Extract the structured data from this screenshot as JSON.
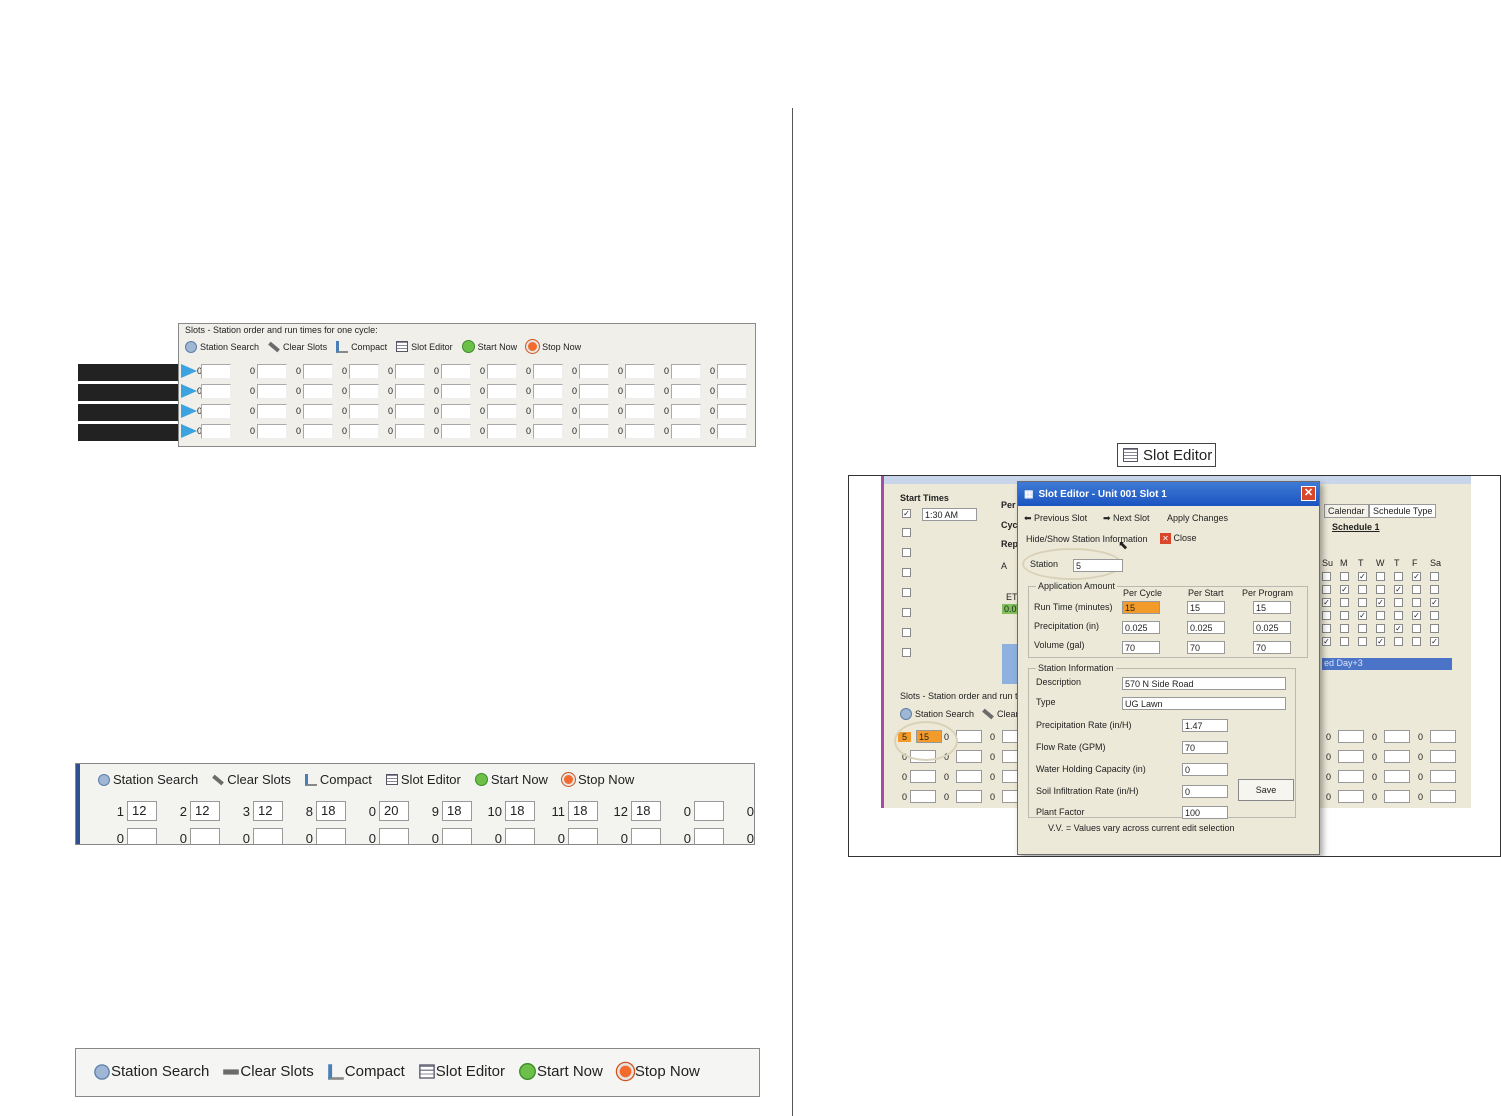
{
  "toolbar": {
    "station_search": "Station Search",
    "clear_slots": "Clear Slots",
    "compact": "Compact",
    "slot_editor": "Slot Editor",
    "start_now": "Start Now",
    "stop_now": "Stop Now"
  },
  "panel1": {
    "title": "Slots - Station order and run times for one cycle:",
    "slot_value": "0"
  },
  "panel2": {
    "row1": [
      {
        "n": "1",
        "v": "12"
      },
      {
        "n": "2",
        "v": "12"
      },
      {
        "n": "3",
        "v": "12"
      },
      {
        "n": "8",
        "v": "18"
      },
      {
        "n": "0",
        "v": "20"
      },
      {
        "n": "9",
        "v": "18"
      },
      {
        "n": "10",
        "v": "18"
      },
      {
        "n": "11",
        "v": "18"
      },
      {
        "n": "12",
        "v": "18"
      },
      {
        "n": "0",
        "v": ""
      },
      {
        "n": "0",
        "v": ""
      }
    ],
    "row2_value": "0"
  },
  "slot_editor_label": "Slot Editor",
  "screenshot": {
    "start_times_label": "Start Times",
    "start_time_value": "1:30 AM",
    "bg_labels": [
      "Per",
      "Cyc",
      "Rep",
      "A",
      "ET"
    ],
    "bg_value": "0.0",
    "tabs": [
      "Calendar",
      "Schedule Type"
    ],
    "schedule_title": "Schedule 1",
    "days": [
      "Su",
      "M",
      "T",
      "W",
      "T",
      "F",
      "Sa"
    ],
    "selection_text": "ed Day+3",
    "slots_text": "Slots - Station order and run t",
    "station_search": "Station Search",
    "clear_short": "Clear",
    "bg_slot_station": "5",
    "bg_slot_value": "15",
    "bg_zero": "0",
    "dialog": {
      "title": "Slot Editor - Unit 001 Slot 1",
      "previous_slot": "Previous Slot",
      "next_slot": "Next Slot",
      "apply_changes": "Apply Changes",
      "hide_show": "Hide/Show Station Information",
      "close": "Close",
      "station_label": "Station",
      "station_value": "5",
      "app_amount": "Application Amount",
      "col_per_cycle": "Per Cycle",
      "col_per_start": "Per Start",
      "col_per_program": "Per Program",
      "run_time_label": "Run Time (minutes)",
      "precip_label": "Precipitation (in)",
      "volume_label": "Volume (gal)",
      "run_time": [
        "15",
        "15",
        "15"
      ],
      "precip": [
        "0.025",
        "0.025",
        "0.025"
      ],
      "volume": [
        "70",
        "70",
        "70"
      ],
      "station_info": "Station Information",
      "description_label": "Description",
      "description": "570 N Side Road",
      "type_label": "Type",
      "type": "UG Lawn",
      "precip_rate_label": "Precipitation Rate (in/H)",
      "precip_rate": "1.47",
      "flow_rate_label": "Flow Rate (GPM)",
      "flow_rate": "70",
      "whc_label": "Water Holding Capacity (in)",
      "whc": "0",
      "soil_label": "Soil Infiltration Rate (in/H)",
      "soil": "0",
      "save": "Save",
      "plant_label": "Plant Factor",
      "plant": "100",
      "vv_note": "V.V. = Values vary across current edit selection"
    }
  }
}
